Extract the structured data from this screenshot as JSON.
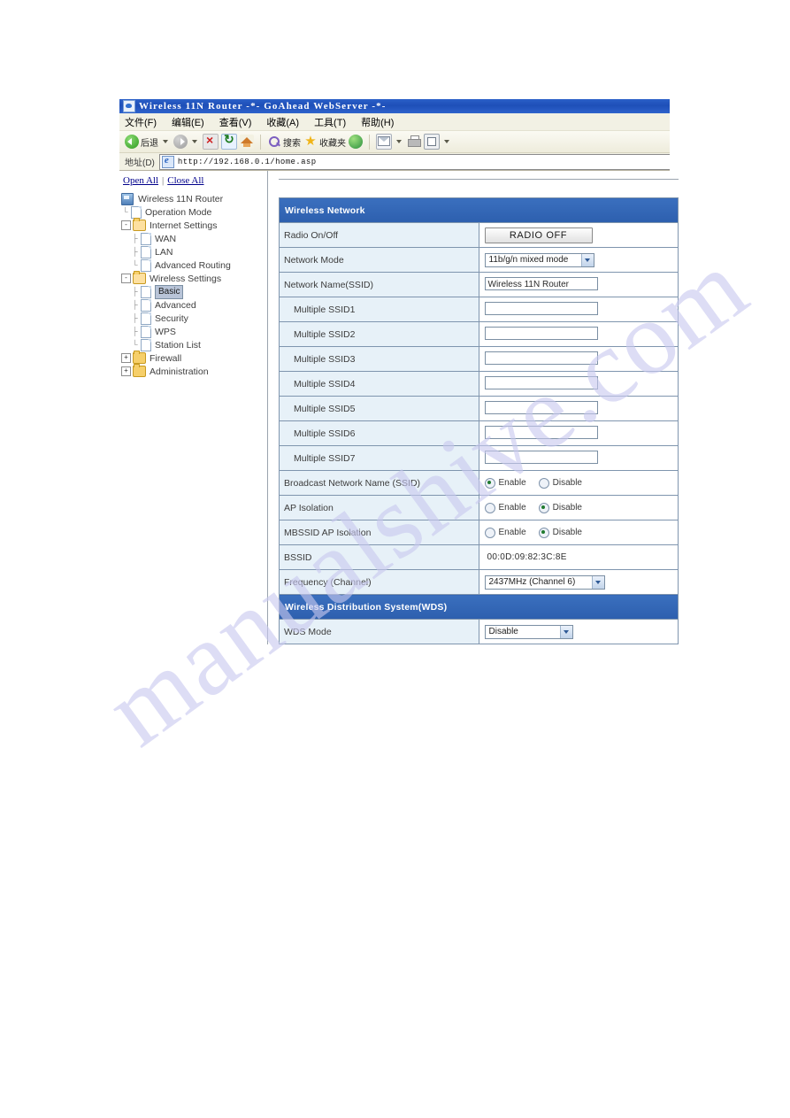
{
  "browser": {
    "window_title": "Wireless 11N Router -*- GoAhead WebServer -*-",
    "title_icon": "ie-document-icon",
    "menu": [
      {
        "label": "文件(F)"
      },
      {
        "label": "编辑(E)"
      },
      {
        "label": "查看(V)"
      },
      {
        "label": "收藏(A)"
      },
      {
        "label": "工具(T)"
      },
      {
        "label": "帮助(H)"
      }
    ],
    "toolbar": {
      "back_label": "后退",
      "search_label": "搜索",
      "favorites_label": "收藏夹",
      "icons": [
        "back-icon",
        "forward-icon",
        "stop-icon",
        "refresh-icon",
        "home-icon",
        "search-icon",
        "favorites-star-icon",
        "history-globe-icon",
        "mail-icon",
        "print-icon",
        "edit-icon"
      ]
    },
    "address": {
      "label": "地址(D)",
      "url": "http://192.168.0.1/home.asp",
      "icon": "ie-page-icon"
    }
  },
  "sidebar": {
    "open_all": "Open All",
    "close_all": "Close All",
    "separator": "|",
    "tree": [
      {
        "label": "Wireless 11N Router",
        "icon": "router-root-icon",
        "level": 0,
        "type": "root",
        "selected": false
      },
      {
        "label": "Operation Mode",
        "icon": "page-icon",
        "level": 1,
        "type": "page",
        "selected": false
      },
      {
        "label": "Internet Settings",
        "icon": "folder-open-icon",
        "level": 0,
        "type": "folder",
        "toggle": "-",
        "selected": false
      },
      {
        "label": "WAN",
        "icon": "page-icon",
        "level": 1,
        "type": "page",
        "selected": false
      },
      {
        "label": "LAN",
        "icon": "page-icon",
        "level": 1,
        "type": "page",
        "selected": false
      },
      {
        "label": "Advanced Routing",
        "icon": "page-icon",
        "level": 1,
        "type": "page",
        "selected": false
      },
      {
        "label": "Wireless Settings",
        "icon": "folder-open-icon",
        "level": 0,
        "type": "folder",
        "toggle": "-",
        "selected": false
      },
      {
        "label": "Basic",
        "icon": "page-icon",
        "level": 1,
        "type": "page",
        "selected": true
      },
      {
        "label": "Advanced",
        "icon": "page-icon",
        "level": 1,
        "type": "page",
        "selected": false
      },
      {
        "label": "Security",
        "icon": "page-icon",
        "level": 1,
        "type": "page",
        "selected": false
      },
      {
        "label": "WPS",
        "icon": "page-icon",
        "level": 1,
        "type": "page",
        "selected": false
      },
      {
        "label": "Station List",
        "icon": "page-icon",
        "level": 1,
        "type": "page",
        "selected": false
      },
      {
        "label": "Firewall",
        "icon": "folder-closed-icon",
        "level": 0,
        "type": "folder",
        "toggle": "+",
        "selected": false
      },
      {
        "label": "Administration",
        "icon": "folder-closed-icon",
        "level": 0,
        "type": "folder",
        "toggle": "+",
        "selected": false
      }
    ]
  },
  "main": {
    "sections": [
      {
        "title": "Wireless Network"
      },
      {
        "title": "Wireless Distribution System(WDS)"
      }
    ],
    "rows": {
      "radio_onoff": {
        "label": "Radio On/Off",
        "button": "RADIO OFF"
      },
      "network_mode": {
        "label": "Network Mode",
        "value": "11b/g/n mixed mode"
      },
      "ssid": {
        "label": "Network Name(SSID)",
        "value": "Wireless 11N Router"
      },
      "mssid1": {
        "label": "Multiple SSID1",
        "value": ""
      },
      "mssid2": {
        "label": "Multiple SSID2",
        "value": ""
      },
      "mssid3": {
        "label": "Multiple SSID3",
        "value": ""
      },
      "mssid4": {
        "label": "Multiple SSID4",
        "value": ""
      },
      "mssid5": {
        "label": "Multiple SSID5",
        "value": ""
      },
      "mssid6": {
        "label": "Multiple SSID6",
        "value": ""
      },
      "mssid7": {
        "label": "Multiple SSID7",
        "value": ""
      },
      "broadcast_ssid": {
        "label": "Broadcast Network Name (SSID)",
        "enable": "Enable",
        "disable": "Disable",
        "selected": "Enable"
      },
      "ap_isolation": {
        "label": "AP Isolation",
        "enable": "Enable",
        "disable": "Disable",
        "selected": "Disable"
      },
      "mbssid_ap_isolation": {
        "label": "MBSSID AP Isolation",
        "enable": "Enable",
        "disable": "Disable",
        "selected": "Disable"
      },
      "bssid": {
        "label": "BSSID",
        "value": "00:0D:09:82:3C:8E"
      },
      "frequency": {
        "label": "Frequency (Channel)",
        "value": "2437MHz (Channel 6)"
      },
      "wds_mode": {
        "label": "WDS Mode",
        "value": "Disable"
      }
    }
  },
  "watermark": {
    "text": "manualshive.com"
  },
  "colors": {
    "section_header": "#2d5fae",
    "label_cell": "#e7f1f8",
    "title_bar": "#1e4fb8",
    "link": "#00008b",
    "radio_dot": "#1f7a2e"
  }
}
